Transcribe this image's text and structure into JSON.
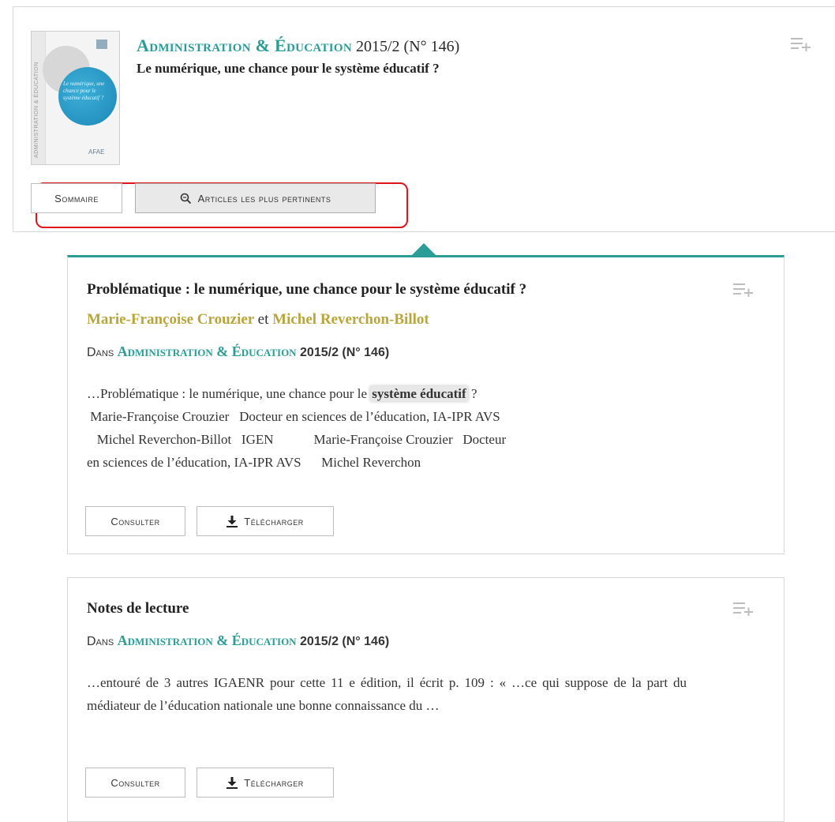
{
  "issue": {
    "journal_name": "Administration & Éducation",
    "issue_number": "2015/2 (N° 146)",
    "title": "Le numérique, une chance pour le système éducatif ?",
    "cover_title": "Le numérique, une chance pour le système éducatif ?",
    "cover_spine": "ADMINISTRATION & ÉDUCATION",
    "cover_logo": "AFAE",
    "buttons": {
      "sommaire": "Sommaire",
      "articles_pertinents": "Articles les plus pertinents"
    }
  },
  "results": [
    {
      "title": "Problématique : le numérique, une chance pour le système éducatif ?",
      "authors": [
        "Marie-Françoise Crouzier",
        "Michel Reverchon-Billot"
      ],
      "authors_separator": "et",
      "in_label": "Dans",
      "journal_name": "Administration & Éducation",
      "issue": "2015/2 (N° 146)",
      "excerpt_before": "…Problématique : le numérique, une chance pour le ",
      "excerpt_highlight": "système éducatif",
      "excerpt_after": " ?\n Marie-Françoise Crouzier   Docteur en sciences de l’éducation, IA-IPR AVS\n   Michel Reverchon-Billot   IGEN            Marie-Françoise Crouzier   Docteur\nen sciences de l’éducation, IA-IPR AVS      Michel Reverchon",
      "consult_label": "Consulter",
      "download_label": "Télécharger"
    },
    {
      "title": "Notes de lecture",
      "in_label": "Dans",
      "journal_name": "Administration & Éducation",
      "issue": "2015/2 (N° 146)",
      "excerpt": "…entouré de 3 autres IGAENR pour cette 11 e  édition, il écrit p. 109 : « …ce qui suppose de la part du médiateur de l’éducation nationale une bonne connaissance du …",
      "consult_label": "Consulter",
      "download_label": "Télécharger"
    }
  ],
  "colors": {
    "accent": "#2a9d96",
    "author": "#b8a63a",
    "highlight_border": "#e0141e"
  }
}
